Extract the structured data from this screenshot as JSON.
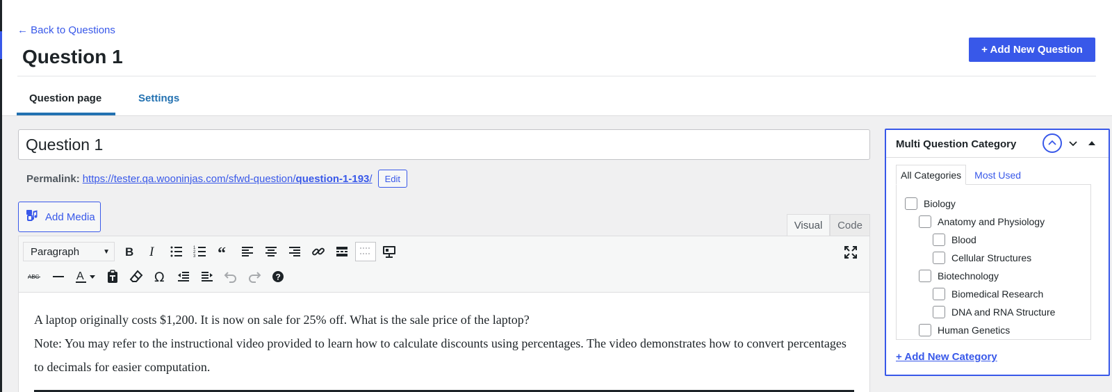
{
  "header": {
    "back_label": "← Back to Questions",
    "title": "Question 1",
    "add_new_label": "+ Add New Question"
  },
  "tabs": [
    {
      "label": "Question page",
      "active": true
    },
    {
      "label": "Settings",
      "active": false
    }
  ],
  "editor": {
    "title_value": "Question 1",
    "permalink_label": "Permalink:",
    "permalink_base": "https://tester.qa.wooninjas.com/sfwd-question/",
    "permalink_slug": "question-1-193",
    "permalink_trail": "/",
    "edit_label": "Edit",
    "add_media_label": "Add Media",
    "mode_tabs": [
      "Visual",
      "Code"
    ],
    "format_value": "Paragraph",
    "paragraphs": [
      "A laptop originally costs $1,200. It is now on sale for 25% off. What is the sale price of the laptop?",
      "Note: You may refer to the instructional video provided to learn how to calculate discounts using percentages. The video demonstrates how to convert percentages to decimals for easier computation."
    ],
    "toolbar_icons_row1": [
      "bold-icon",
      "italic-icon",
      "bulleted-list-icon",
      "numbered-list-icon",
      "blockquote-icon",
      "align-left-icon",
      "align-center-icon",
      "align-right-icon",
      "link-icon",
      "read-more-icon",
      "toolbar-toggle-icon",
      "media-embed-icon"
    ],
    "toolbar_icons_row2": [
      "strikethrough-icon",
      "horizontal-line-icon",
      "text-color-icon",
      "paste-text-icon",
      "clear-formatting-icon",
      "special-character-icon",
      "outdent-icon",
      "indent-icon",
      "undo-icon",
      "redo-icon",
      "help-icon"
    ]
  },
  "categories": {
    "title": "Multi Question Category",
    "tab_all": "All Categories",
    "tab_most_used": "Most Used",
    "items": [
      {
        "label": "Biology",
        "level": 0,
        "checked": false
      },
      {
        "label": "Anatomy and Physiology",
        "level": 1,
        "checked": false
      },
      {
        "label": "Blood",
        "level": 2,
        "checked": false
      },
      {
        "label": "Cellular Structures",
        "level": 2,
        "checked": false
      },
      {
        "label": "Biotechnology",
        "level": 1,
        "checked": false
      },
      {
        "label": "Biomedical Research",
        "level": 2,
        "checked": false
      },
      {
        "label": "DNA and RNA Structure",
        "level": 2,
        "checked": false
      },
      {
        "label": "Human Genetics",
        "level": 1,
        "checked": false
      }
    ],
    "add_new_label": "+ Add New Category"
  },
  "colors": {
    "accent": "#3858e9",
    "tab_accent": "#2271b1",
    "text": "#1d2327"
  }
}
